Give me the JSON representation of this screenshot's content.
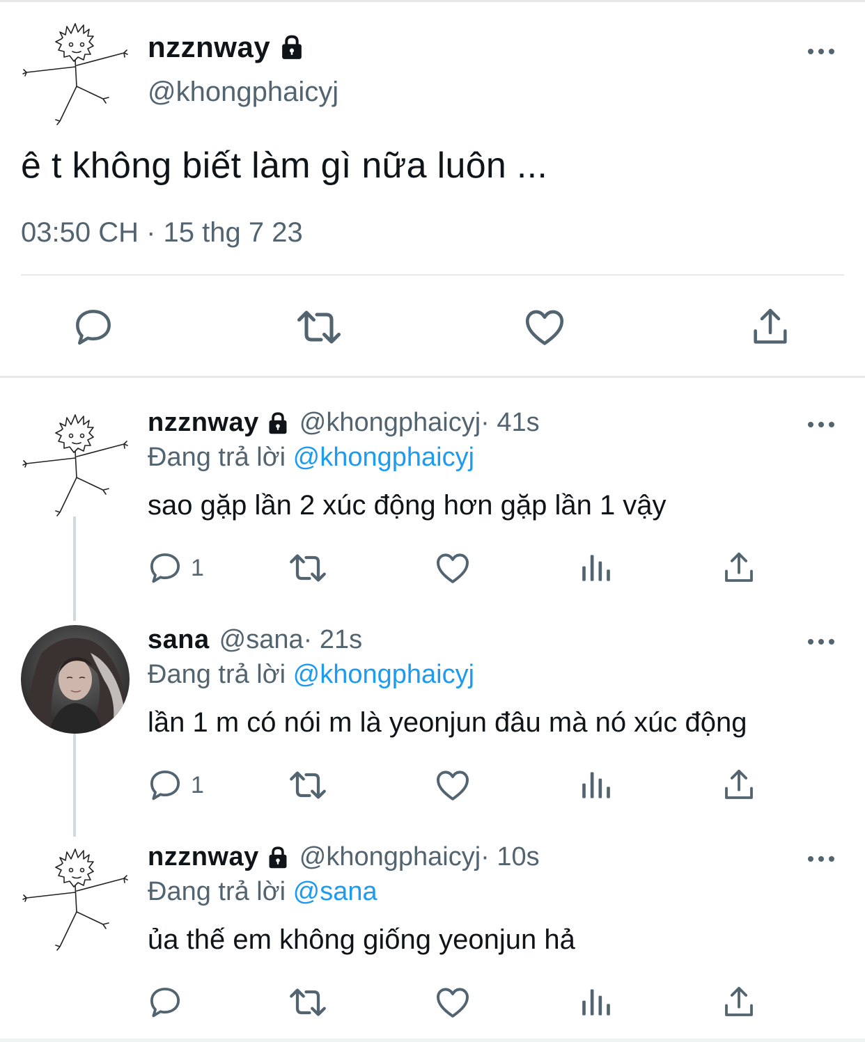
{
  "main": {
    "name": "nzznway",
    "handle": "@khongphaicyj",
    "text": "ê t không biết làm gì nữa luôn ...",
    "time": "03:50 CH · 15 thg 7 23"
  },
  "replies": [
    {
      "name": "nzznway",
      "handle": "@khongphaicyj",
      "time": " · 41s",
      "replying_prefix": "Đang trả lời ",
      "replying_to": "@khongphaicyj",
      "text": "sao gặp lần 2 xúc động hơn gặp lần 1 vậy",
      "reply_count": "1"
    },
    {
      "name": "sana",
      "handle": "@sana",
      "time": " · 21s",
      "replying_prefix": "Đang trả lời ",
      "replying_to": "@khongphaicyj",
      "text": "lần 1 m có nói m là yeonjun đâu mà nó xúc động",
      "reply_count": "1"
    },
    {
      "name": "nzznway",
      "handle": "@khongphaicyj",
      "time": " · 10s",
      "replying_prefix": "Đang trả lời ",
      "replying_to": "@sana",
      "text": "ủa thế em không giống yeonjun hả",
      "reply_count": ""
    }
  ],
  "colors": {
    "text": "#0f1419",
    "muted": "#536471",
    "link": "#1d9bf0",
    "divider": "#e7e9ea"
  },
  "icons": [
    "reply-icon",
    "retweet-icon",
    "like-icon",
    "share-icon",
    "views-icon",
    "lock-icon",
    "more-icon"
  ]
}
